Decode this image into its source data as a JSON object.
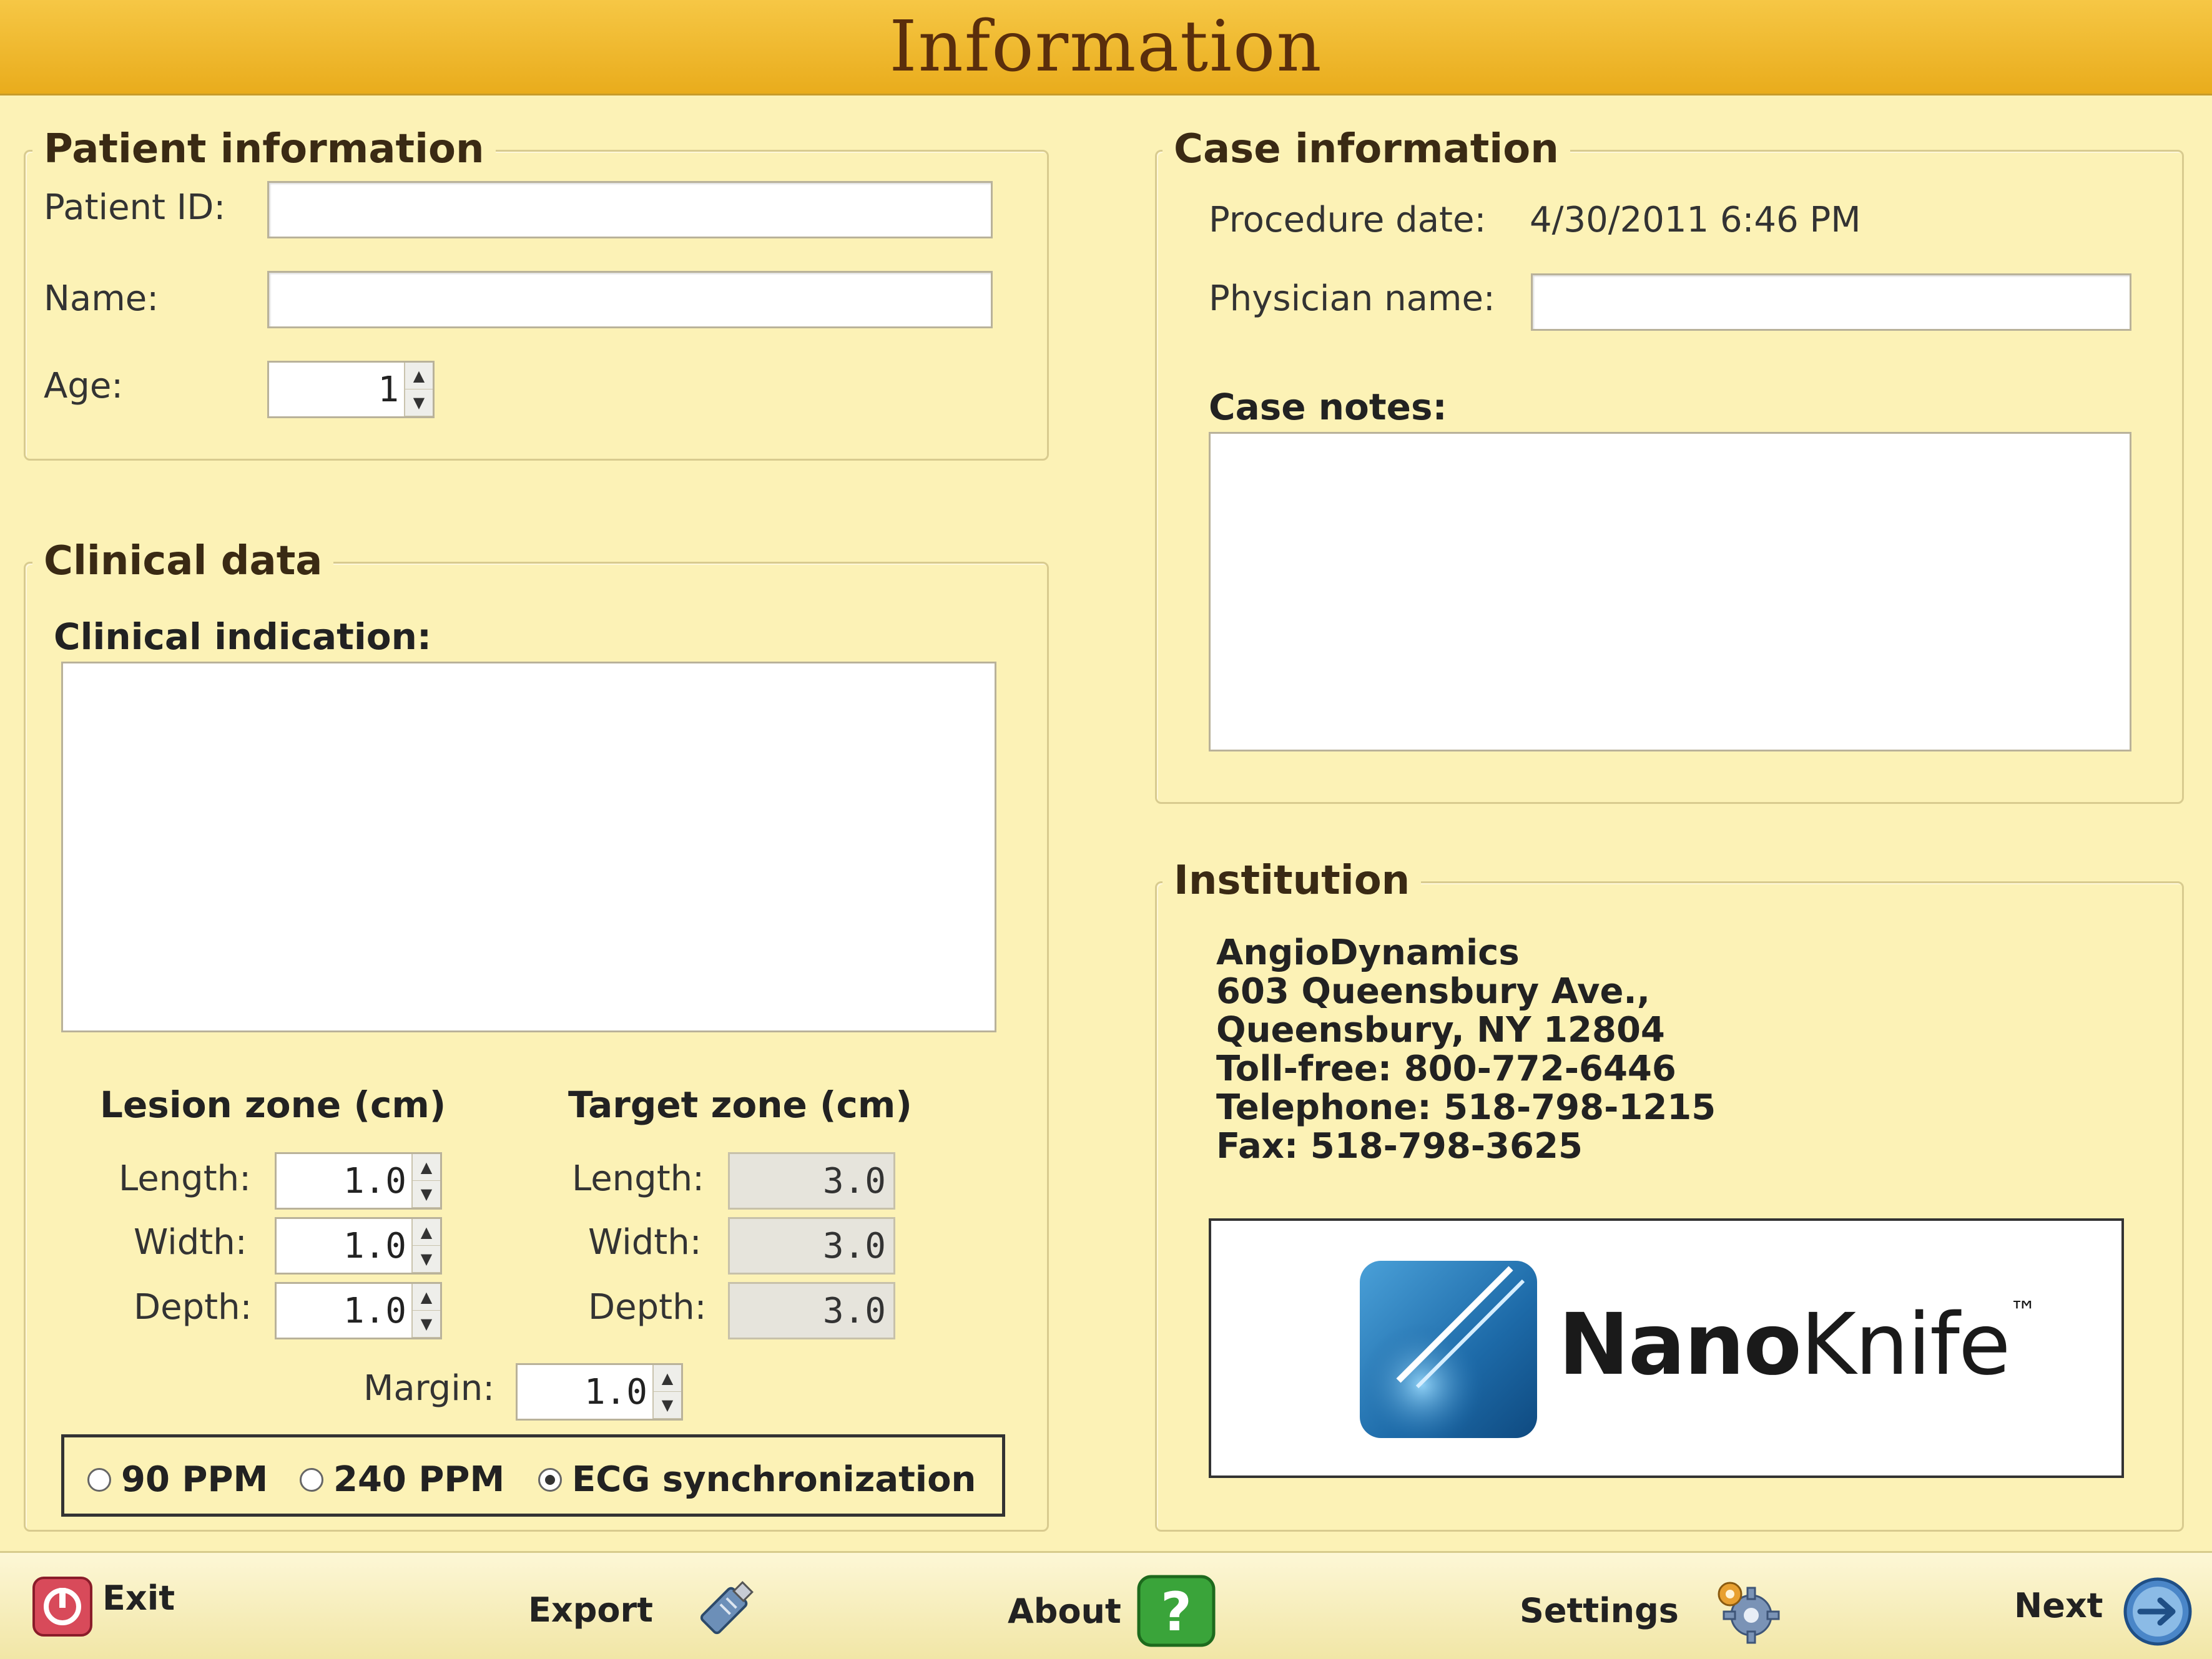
{
  "window": {
    "title": "Information"
  },
  "patient": {
    "legend": "Patient information",
    "id_label": "Patient ID:",
    "id_value": "",
    "name_label": "Name:",
    "name_value": "",
    "age_label": "Age:",
    "age_value": "1"
  },
  "case": {
    "legend": "Case information",
    "date_label": "Procedure date:",
    "date_value": "4/30/2011 6:46 PM",
    "physician_label": "Physician name:",
    "physician_value": "",
    "notes_label": "Case notes:"
  },
  "clinical": {
    "legend": "Clinical data",
    "indication_label": "Clinical indication:",
    "lesion_title": "Lesion zone (cm)",
    "target_title": "Target zone (cm)",
    "length_label": "Length:",
    "width_label": "Width:",
    "depth_label": "Depth:",
    "lesion_length": "1.0",
    "lesion_width": "1.0",
    "lesion_depth": "1.0",
    "target_length": "3.0",
    "target_width": "3.0",
    "target_depth": "3.0",
    "margin_label": "Margin:",
    "margin_value": "1.0",
    "modes": [
      {
        "label": "90 PPM",
        "selected": false
      },
      {
        "label": "240 PPM",
        "selected": false
      },
      {
        "label": "ECG synchronization",
        "selected": true
      }
    ]
  },
  "institution": {
    "legend": "Institution",
    "lines": [
      "AngioDynamics",
      "603 Queensbury Ave.,",
      "Queensbury, NY 12804",
      "Toll-free: 800-772-6446",
      "Telephone: 518-798-1215",
      "Fax: 518-798-3625"
    ],
    "logo_text_bold": "Nano",
    "logo_text_light": "Knife",
    "logo_tm": "™"
  },
  "footer": {
    "exit_label": "Exit",
    "export_label": "Export",
    "about_label": "About",
    "settings_label": "Settings",
    "next_label": "Next"
  },
  "colors": {
    "title_bar": "#f2bd36",
    "panel_bg": "#fcf2b6",
    "about_icon": "#3aa43a",
    "exit_icon": "#d84a5a",
    "next_icon": "#4a86c8"
  }
}
